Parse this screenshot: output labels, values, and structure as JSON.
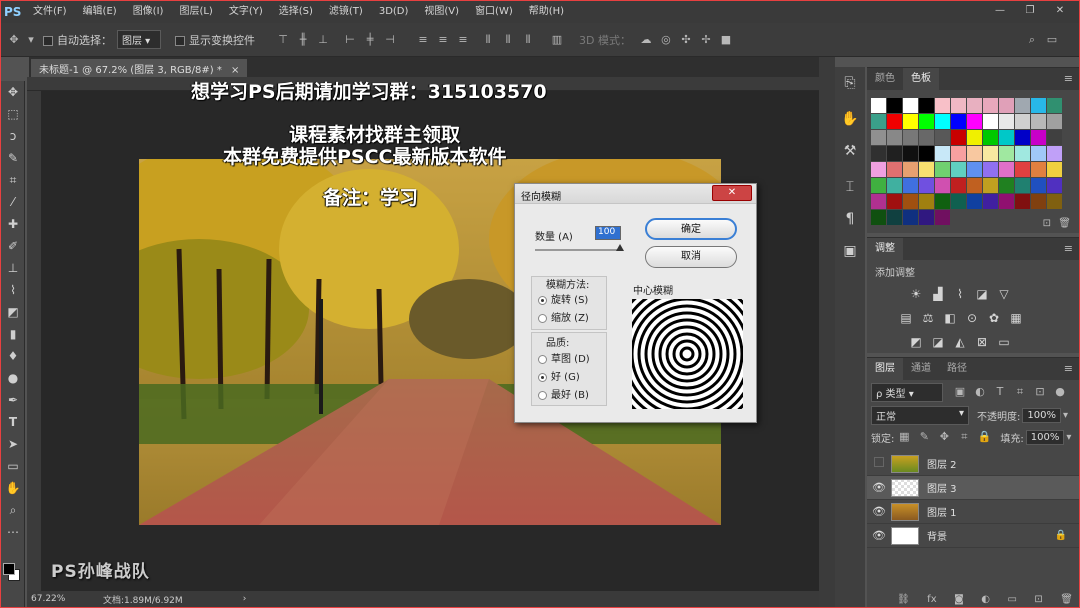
{
  "app": {
    "logo": "PS"
  },
  "menu": [
    "文件(F)",
    "编辑(E)",
    "图像(I)",
    "图层(L)",
    "文字(Y)",
    "选择(S)",
    "滤镜(T)",
    "3D(D)",
    "视图(V)",
    "窗口(W)",
    "帮助(H)"
  ],
  "options": {
    "auto_select": "自动选择：",
    "layer_select": "图层",
    "show_transform": "显示变换控件",
    "mode_3d": "3D 模式："
  },
  "document": {
    "tab_title": "未标题-1 @ 67.2% (图层 3, RGB/8#) *",
    "zoom": "67.22%",
    "doc_info": "文档:1.89M/6.92M"
  },
  "overlay": {
    "line1": "想学习PS后期请加学习群：315103570",
    "line2": "课程素材找群主领取",
    "line3": "本群免费提供PSCC最新版本软件",
    "line4": "备注：学习"
  },
  "watermark": "PS孙峰战队",
  "dialog": {
    "title": "径向模糊",
    "amount_label": "数量 (A)",
    "amount_value": "100",
    "ok": "确定",
    "cancel": "取消",
    "method_label": "模糊方法:",
    "method_spin": "旋转 (S)",
    "method_zoom": "缩放 (Z)",
    "quality_label": "品质:",
    "quality_draft": "草图 (D)",
    "quality_good": "好 (G)",
    "quality_best": "最好 (B)",
    "center_label": "中心模糊"
  },
  "color_panel": {
    "tab_color": "颜色",
    "tab_swatches": "色板"
  },
  "adjust_panel": {
    "tab": "调整",
    "add_label": "添加调整"
  },
  "layers_panel": {
    "tab_layers": "图层",
    "tab_channels": "通道",
    "tab_paths": "路径",
    "kind": "ρ 类型",
    "blend": "正常",
    "opacity_label": "不透明度:",
    "opacity": "100%",
    "lock_label": "锁定:",
    "fill_label": "填充:",
    "fill": "100%",
    "layers": [
      {
        "name": "图层 2",
        "visible": false,
        "selected": false
      },
      {
        "name": "图层 3",
        "visible": true,
        "selected": true
      },
      {
        "name": "图层 1",
        "visible": true,
        "selected": false
      },
      {
        "name": "背景",
        "visible": true,
        "selected": false
      }
    ]
  },
  "swatch_colors": [
    "#ffffff",
    "#000000",
    "#ffffff",
    "#000000",
    "#f8c0c8",
    "#f0b8c4",
    "#e8b0c0",
    "#e8a8bc",
    "#e0a0b8",
    "#a0a8b0",
    "#28b8e8",
    "#309070",
    "#3aa08a",
    "#f00000",
    "#ffff00",
    "#00ff00",
    "#00ffff",
    "#0000ff",
    "#ff00ff",
    "#ffffff",
    "#e8e8e8",
    "#d0d0d0",
    "#b8b8b8",
    "#a0a0a0",
    "#909090",
    "#888888",
    "#787878",
    "#686868",
    "#585858",
    "#c80000",
    "#f0f000",
    "#00c800",
    "#00c8c8",
    "#0000c8",
    "#c800c8",
    "#404040",
    "#303030",
    "#202020",
    "#101010",
    "#000000",
    "#c8e8f8",
    "#f8a0a0",
    "#f8c8a0",
    "#f8e8a0",
    "#a0e8a0",
    "#a0e8e0",
    "#a0c8f8",
    "#c0a0f8",
    "#f0a0e0",
    "#e07070",
    "#e8a070",
    "#f8e070",
    "#70d070",
    "#60d0c0",
    "#6090f0",
    "#9070f0",
    "#e070c8",
    "#e04040",
    "#e08040",
    "#f0d040",
    "#40b040",
    "#40b0a0",
    "#4070e0",
    "#7050e0",
    "#d050b0",
    "#c02020",
    "#c06020",
    "#c0a020",
    "#208020",
    "#208070",
    "#2050c0",
    "#5030c0",
    "#b03090",
    "#a01010",
    "#a05010",
    "#a08010",
    "#106010",
    "#106050",
    "#1040a0",
    "#4020a0",
    "#901070",
    "#801010",
    "#804010",
    "#806010",
    "#105010",
    "#104040",
    "#103080",
    "#301880",
    "#701060"
  ]
}
